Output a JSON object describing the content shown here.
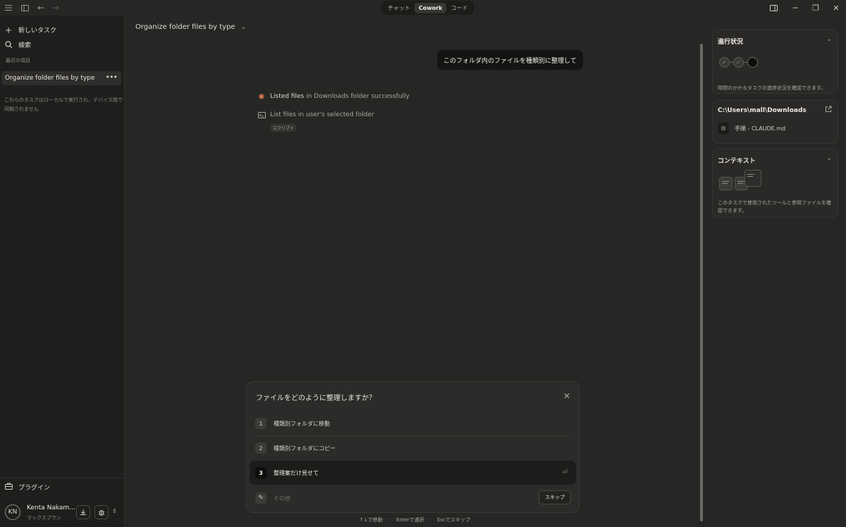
{
  "topbar": {
    "modes": [
      "チャット",
      "Cowork",
      "コード"
    ],
    "active_mode": "Cowork"
  },
  "sidebar": {
    "new_task": "新しいタスク",
    "search": "検索",
    "recent_caption": "最近の項目",
    "recent_item": "Organize folder files by type",
    "local_note": "これらのタスクはローカルで実行され、デバイス間で同期されません",
    "plugins": "プラグイン",
    "user": {
      "initials": "KN",
      "name": "Kenta Nakam...",
      "plan": "マックスプラン"
    }
  },
  "main": {
    "title": "Organize folder files by type",
    "user_message": "このフォルダ内のファイルを種類別に整理して",
    "steps": [
      {
        "highlight": "Listed files",
        "rest": " in Downloads folder successfully"
      },
      {
        "text": "List files in user's selected folder",
        "tag": "スクリプト"
      }
    ]
  },
  "dialog": {
    "title": "ファイルをどのように整理しますか？",
    "options": [
      {
        "num": "1",
        "label": "種類別フォルダに移動"
      },
      {
        "num": "2",
        "label": "種類別フォルダにコピー"
      },
      {
        "num": "3",
        "label": "整理案だけ見せて",
        "selected": true
      }
    ],
    "other_placeholder": "その他",
    "skip": "スキップ",
    "hints": {
      "move": "↑↓で移動",
      "select": "Enterで選択",
      "skip": "Escでスキップ"
    }
  },
  "right_panel": {
    "progress": {
      "title": "進行状況",
      "desc": "時間のかかるタスクの進捗状況を確認できます。"
    },
    "folder": {
      "path": "C:\\Users\\mall\\Downloads",
      "file": "手順 - CLAUDE.md"
    },
    "context": {
      "title": "コンテキスト",
      "desc": "このタスクで使用されたツールと参照ファイルを確認できます。"
    }
  },
  "colors": {
    "background": "#262624",
    "sidebar": "#1f1e1d",
    "accent_orange": "#d97757"
  }
}
